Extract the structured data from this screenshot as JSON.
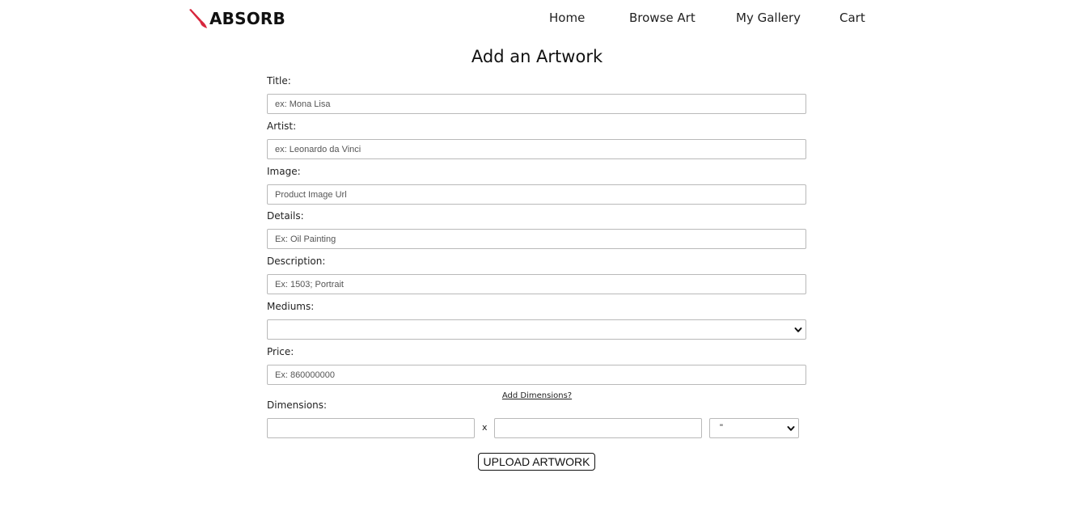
{
  "brand": {
    "name": "ABSORB",
    "accent_color": "#d7263d",
    "icon": "paintbrush-icon"
  },
  "nav": {
    "items": [
      "Home",
      "Browse Art",
      "My Gallery",
      "Cart"
    ]
  },
  "form": {
    "title": "Add an Artwork",
    "fields": {
      "title": {
        "label": "Title:",
        "placeholder": "ex: Mona Lisa",
        "value": ""
      },
      "artist": {
        "label": "Artist:",
        "placeholder": "ex: Leonardo da Vinci",
        "value": ""
      },
      "image": {
        "label": "Image:",
        "placeholder": "Product Image Url",
        "value": ""
      },
      "details": {
        "label": "Details:",
        "placeholder": "Ex: Oil Painting",
        "value": ""
      },
      "description": {
        "label": "Description:",
        "placeholder": "Ex: 1503; Portrait",
        "value": ""
      },
      "mediums": {
        "label": "Mediums:",
        "selected": ""
      },
      "price": {
        "label": "Price:",
        "placeholder": "Ex: 860000000",
        "value": ""
      }
    },
    "add_dimensions_link": "Add Dimensions?",
    "dimensions": {
      "label": "Dimensions:",
      "separator": "x",
      "unit_selected": "\""
    },
    "submit_label": "UPLOAD ARTWORK"
  }
}
